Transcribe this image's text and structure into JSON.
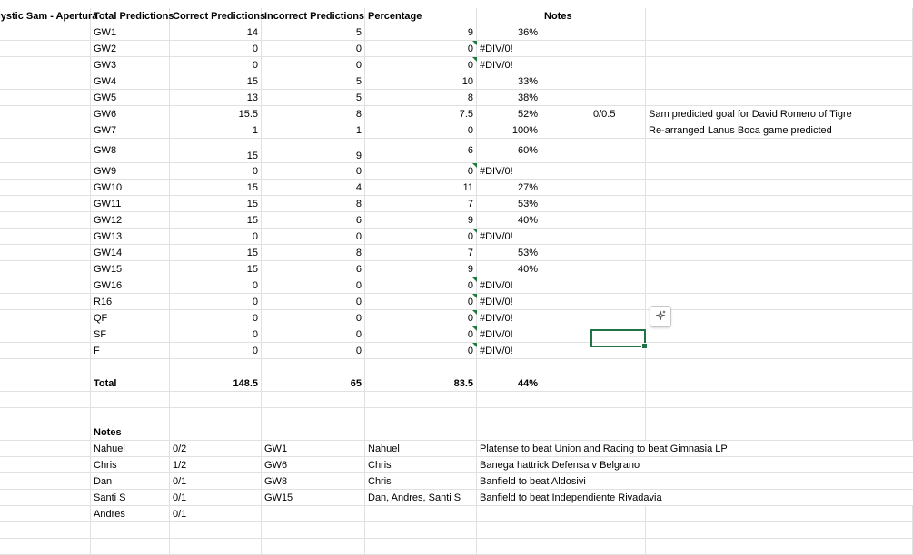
{
  "headers": {
    "title": "Mystic Sam - Apertura",
    "total": "Total Predictions",
    "correct": "Correct Predictions",
    "incorrect": "Incorrect Predictions",
    "pct": "Percentage",
    "notes": "Notes"
  },
  "rows": [
    {
      "gw": "GW1",
      "total": "14",
      "correct": "5",
      "incorrect": "9",
      "pct": "36%"
    },
    {
      "gw": "GW2",
      "total": "0",
      "correct": "0",
      "incorrect": "0",
      "pct": "#DIV/0!"
    },
    {
      "gw": "GW3",
      "total": "0",
      "correct": "0",
      "incorrect": "0",
      "pct": "#DIV/0!"
    },
    {
      "gw": "GW4",
      "total": "15",
      "correct": "5",
      "incorrect": "10",
      "pct": "33%"
    },
    {
      "gw": "GW5",
      "total": "13",
      "correct": "5",
      "incorrect": "8",
      "pct": "38%"
    },
    {
      "gw": "GW6",
      "total": "15.5",
      "correct": "8",
      "incorrect": "7.5",
      "pct": "52%",
      "note": "0/0.5",
      "note_text": "Sam predicted goal for David Romero of Tigre"
    },
    {
      "gw": "GW7",
      "total": "1",
      "correct": "1",
      "incorrect": "0",
      "pct": "100%",
      "note_text": "Re-arranged Lanus Boca game predicted"
    },
    {
      "gw": "GW8",
      "total": "15",
      "correct": "9",
      "incorrect": "6",
      "pct": "60%"
    },
    {
      "gw": "GW9",
      "total": "0",
      "correct": "0",
      "incorrect": "0",
      "pct": "#DIV/0!"
    },
    {
      "gw": "GW10",
      "total": "15",
      "correct": "4",
      "incorrect": "11",
      "pct": "27%"
    },
    {
      "gw": "GW11",
      "total": "15",
      "correct": "8",
      "incorrect": "7",
      "pct": "53%"
    },
    {
      "gw": "GW12",
      "total": "15",
      "correct": "6",
      "incorrect": "9",
      "pct": "40%"
    },
    {
      "gw": "GW13",
      "total": "0",
      "correct": "0",
      "incorrect": "0",
      "pct": "#DIV/0!"
    },
    {
      "gw": "GW14",
      "total": "15",
      "correct": "8",
      "incorrect": "7",
      "pct": "53%"
    },
    {
      "gw": "GW15",
      "total": "15",
      "correct": "6",
      "incorrect": "9",
      "pct": "40%"
    },
    {
      "gw": "GW16",
      "total": "0",
      "correct": "0",
      "incorrect": "0",
      "pct": "#DIV/0!"
    },
    {
      "gw": "R16",
      "total": "0",
      "correct": "0",
      "incorrect": "0",
      "pct": "#DIV/0!"
    },
    {
      "gw": "QF",
      "total": "0",
      "correct": "0",
      "incorrect": "0",
      "pct": "#DIV/0!"
    },
    {
      "gw": "SF",
      "total": "0",
      "correct": "0",
      "incorrect": "0",
      "pct": "#DIV/0!"
    },
    {
      "gw": "F",
      "total": "0",
      "correct": "0",
      "incorrect": "0",
      "pct": "#DIV/0!"
    }
  ],
  "totals": {
    "label": "Total",
    "total": "148.5",
    "correct": "65",
    "incorrect": "83.5",
    "pct": "44%"
  },
  "notes_section": {
    "title": "Notes",
    "people": [
      {
        "name": "Nahuel",
        "score": "0/2"
      },
      {
        "name": "Chris",
        "score": "1/2"
      },
      {
        "name": "Dan",
        "score": "0/1"
      },
      {
        "name": "Santi S",
        "score": "0/1"
      },
      {
        "name": "Andres",
        "score": "0/1"
      }
    ],
    "details": [
      {
        "gw": "GW1",
        "who": "Nahuel",
        "text": "Platense to beat Union and Racing to beat Gimnasia LP"
      },
      {
        "gw": "GW6",
        "who": "Chris",
        "text": "Banega hattrick Defensa v Belgrano"
      },
      {
        "gw": "GW8",
        "who": "Chris",
        "text": "Banfield to beat Aldosivi"
      },
      {
        "gw": "GW15",
        "who": "Dan, Andres, Santi S",
        "text": "Banfield to beat Independiente Rivadavia"
      }
    ]
  },
  "icons": {
    "ai": "sparkle-icon"
  },
  "colors": {
    "selection": "#217346",
    "gridline": "#e1e1e1",
    "error_indicator": "#1e7b3a"
  }
}
